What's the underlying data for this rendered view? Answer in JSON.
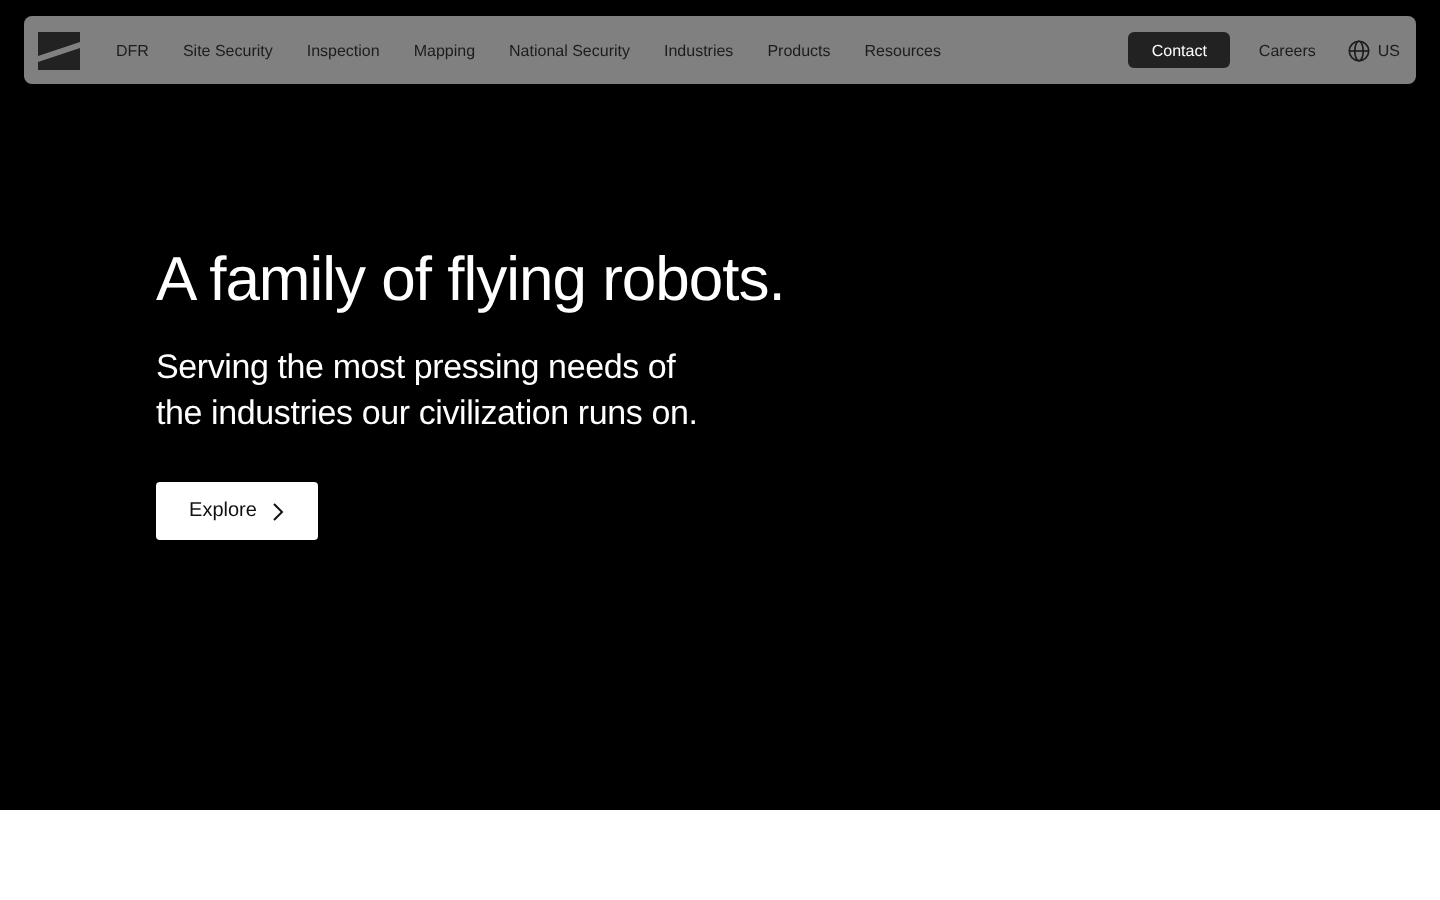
{
  "nav": {
    "items": [
      "DFR",
      "Site Security",
      "Inspection",
      "Mapping",
      "National Security",
      "Industries",
      "Products",
      "Resources"
    ],
    "contact": "Contact",
    "careers": "Careers",
    "locale": "US"
  },
  "hero": {
    "title": "A family of flying robots.",
    "subtitle": "Serving the most pressing needs of\nthe industries our civilization runs on.",
    "button": "Explore"
  }
}
